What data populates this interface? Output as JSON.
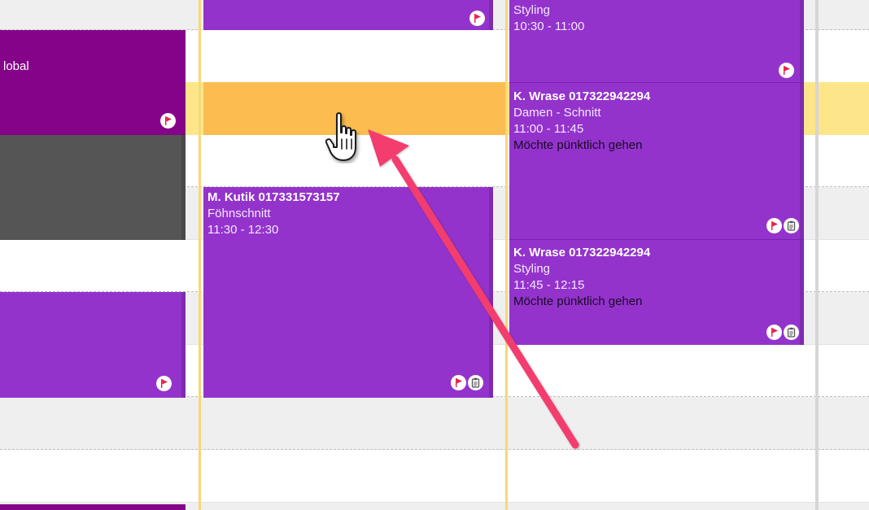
{
  "calendar": {
    "col1": {
      "appt_global": {
        "text": "lobal",
        "icon": "flag-icon"
      },
      "appt_blocked": {},
      "appt_lower": {
        "icon": "flag-icon"
      }
    },
    "col2": {
      "appt_top": {
        "icon": "flag-icon"
      },
      "appt_selected": {},
      "appt_kutik": {
        "name": "M. Kutik 017331573157",
        "service": "Föhnschnitt",
        "time": "11:30 - 12:30",
        "icons": [
          "flag-icon",
          "clipboard-icon"
        ]
      }
    },
    "col3": {
      "appt_styling_top": {
        "service": "Styling",
        "time": "10:30 - 11:00",
        "icon": "flag-icon"
      },
      "appt_wrase_1": {
        "name": "K. Wrase 017322942294",
        "service": "Damen - Schnitt",
        "time": "11:00 - 11:45",
        "note": "Möchte pünktlich gehen",
        "icons": [
          "flag-icon",
          "clipboard-icon"
        ]
      },
      "appt_wrase_2": {
        "name": "K. Wrase 017322942294",
        "service": "Styling",
        "time": "11:45 - 12:15",
        "note": "Möchte pünktlich gehen",
        "icons": [
          "flag-icon",
          "clipboard-icon"
        ]
      }
    }
  },
  "colors": {
    "violet": "#9333cc",
    "magenta": "#850389",
    "dark_grey": "#555555",
    "orange_selection": "#fbbd4f",
    "highlight_row": "#fde68a",
    "arrow": "#f23c6e",
    "flag_red": "#e91e4f"
  },
  "overlay": {
    "cursor": "hand-pointer-icon",
    "arrow": "arrow-annotation"
  }
}
